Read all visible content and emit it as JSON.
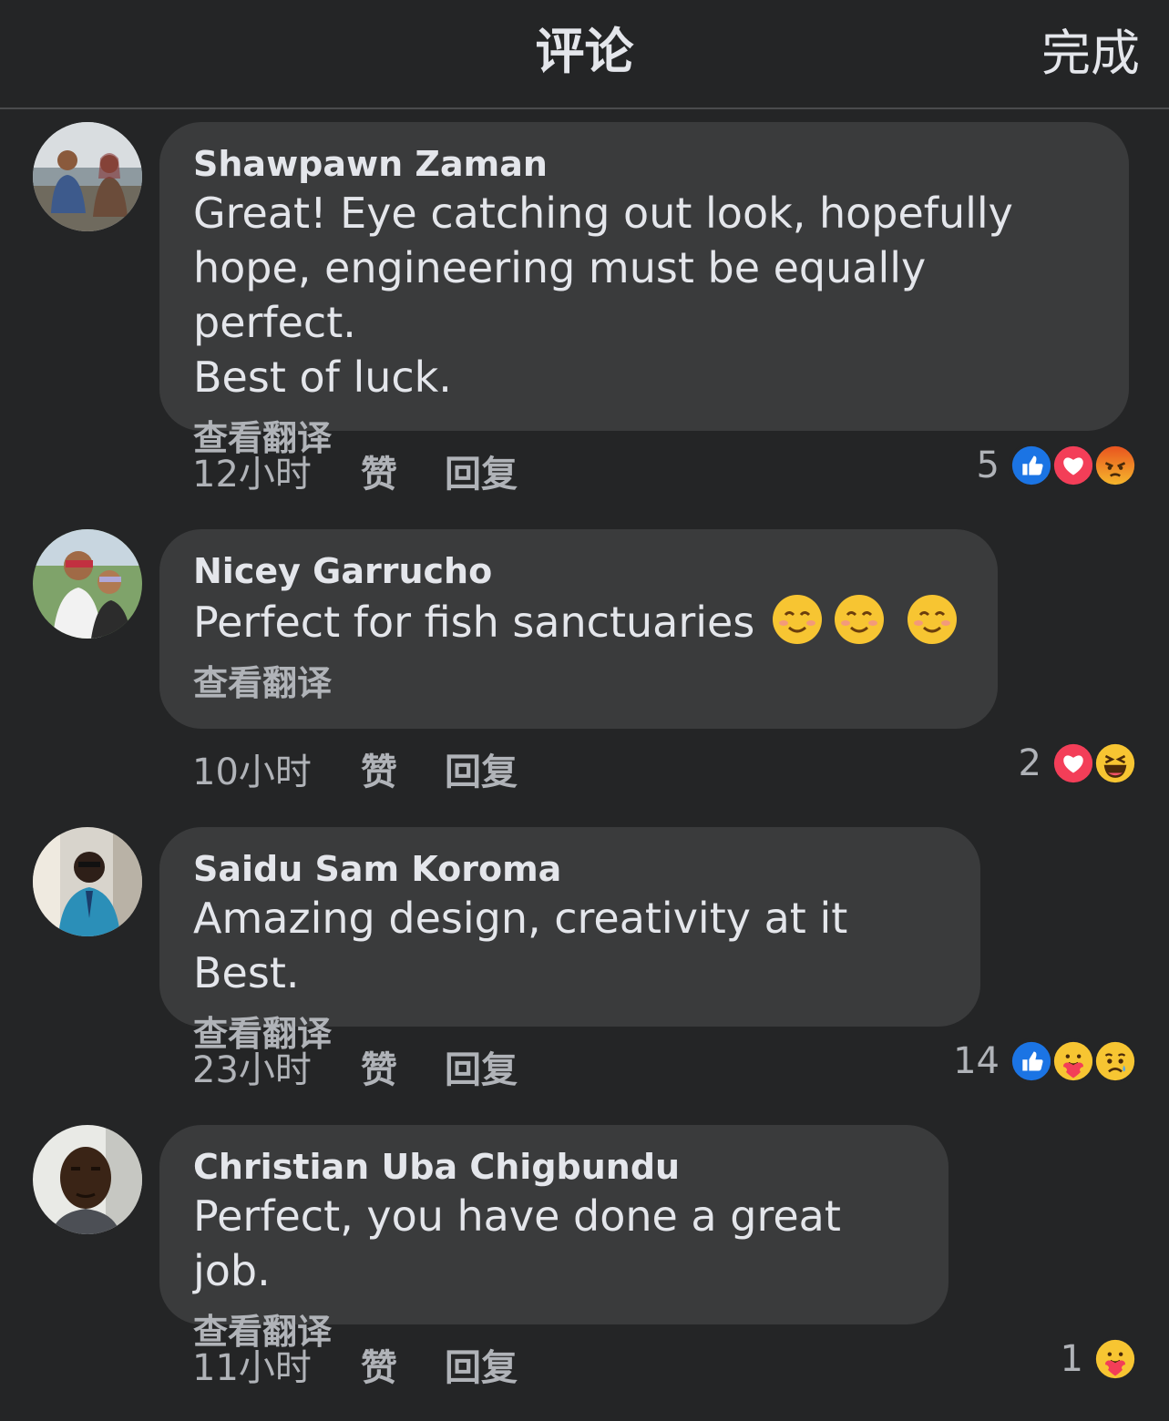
{
  "header": {
    "title": "评论",
    "done_label": "完成"
  },
  "translate_label": "查看翻译",
  "like_label": "赞",
  "reply_label": "回复",
  "comments": [
    {
      "author": "Shawpawn Zaman",
      "text": "Great! Eye catching out look, hopefully\nhope,  engineering must be equally perfect.\nBest of luck.",
      "time": "12小时",
      "reaction_count": "5",
      "reactions": [
        "like",
        "love",
        "angry"
      ]
    },
    {
      "author": "Nicey Garrucho",
      "text": "Perfect for fish sanctuaries",
      "emojis": [
        "smiling-face",
        "smiling-face",
        "smiling-face"
      ],
      "time": "10小时",
      "reaction_count": "2",
      "reactions": [
        "love",
        "haha"
      ]
    },
    {
      "author": "Saidu Sam Koroma",
      "text": "Amazing design, creativity at it Best.",
      "time": "23小时",
      "reaction_count": "14",
      "reactions": [
        "like",
        "care",
        "sad"
      ]
    },
    {
      "author": "Christian Uba Chigbundu",
      "text": "Perfect, you have done a great job.",
      "time": "11小时",
      "reaction_count": "1",
      "reactions": [
        "care"
      ]
    }
  ]
}
